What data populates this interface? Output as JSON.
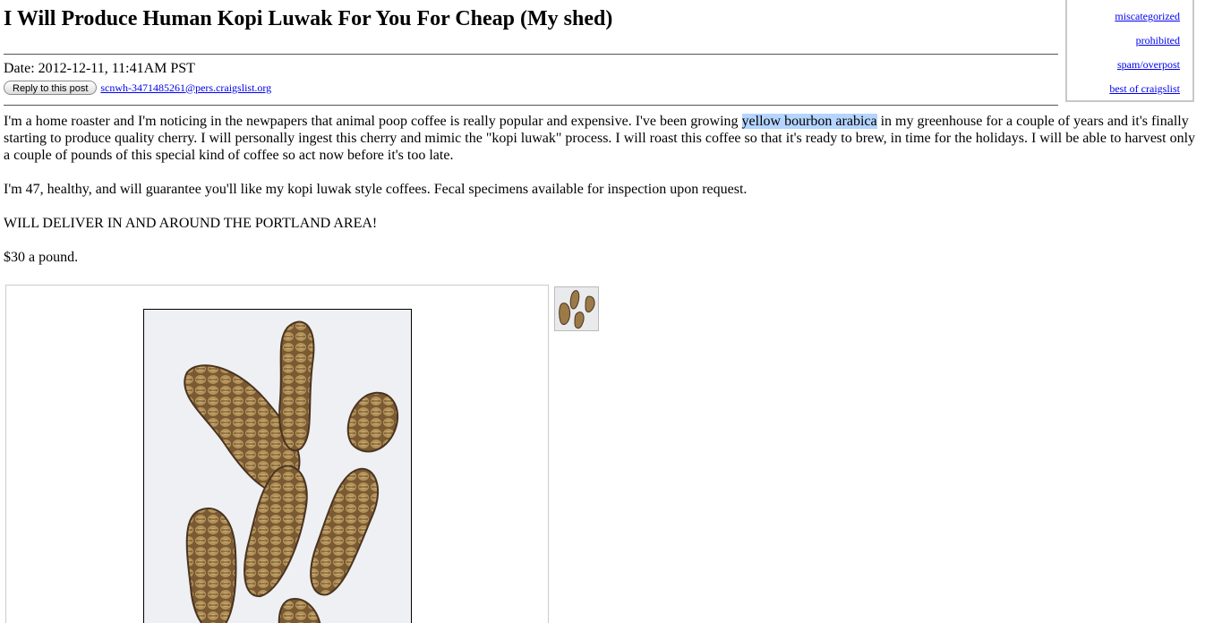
{
  "post": {
    "title": "I Will Produce Human Kopi Luwak For You For Cheap (My shed)",
    "date_line": "Date: 2012-12-11, 11:41AM PST",
    "reply_button": "Reply to this post",
    "reply_email": "scnwh-3471485261@pers.craigslist.org"
  },
  "flag_links": {
    "miscategorized": "miscategorized",
    "prohibited": "prohibited",
    "spam": "spam/overpost",
    "best": "best of craigslist"
  },
  "body": {
    "p1_before": "I'm a home roaster and I'm noticing in the newpapers that animal poop coffee is really popular and expensive. I've been growing ",
    "p1_highlight": "yellow bourbon arabica",
    "p1_after": " in my greenhouse for a couple of years and it's finally starting to produce quality cherry. I will personally ingest this cherry and mimic the \"kopi luwak\" process. I will roast this coffee so that it's ready to brew, in time for the holidays. I will be able to harvest only a couple of pounds of this special kind of coffee so act now before it's too late.",
    "p2": "I'm 47, healthy, and will guarantee you'll like my kopi luwak style coffees. Fecal specimens available for inspection upon request.",
    "p3": "WILL DELIVER IN AND AROUND THE PORTLAND AREA!",
    "p4": "$30 a pound."
  },
  "colors": {
    "link": "#0000ee",
    "selection": "#b5d5ff",
    "photo_background": "#eef0f3",
    "bean_brown": "#8b6a3e"
  }
}
